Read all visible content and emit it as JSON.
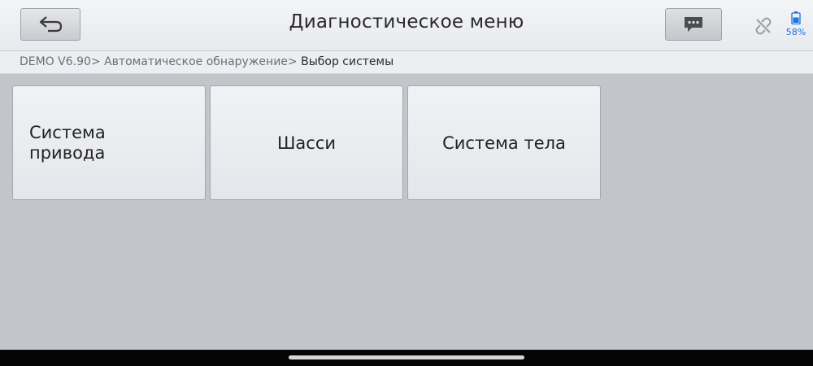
{
  "header": {
    "title": "Диагностическое меню",
    "battery_percent": "58%"
  },
  "breadcrumb": {
    "path": "DEMO V6.90> Автоматическое обнаружение>",
    "current": " Выбор системы"
  },
  "systems": [
    {
      "label": "Система привода"
    },
    {
      "label": "Шасси"
    },
    {
      "label": "Система тела"
    }
  ],
  "colors": {
    "background": "#c3c5cb",
    "accent_battery": "#1a73e8"
  }
}
